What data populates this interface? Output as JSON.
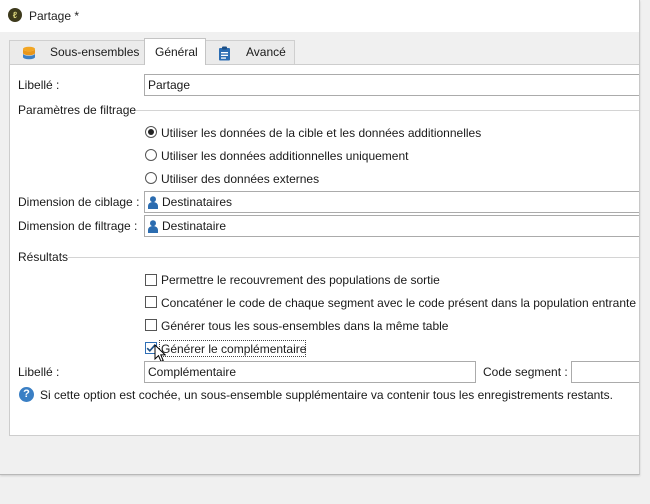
{
  "window": {
    "title": "Partage *"
  },
  "tabs": [
    {
      "label": "Sous-ensembles",
      "icon": "database-icon",
      "active": false
    },
    {
      "label": "Général",
      "active": true
    },
    {
      "label": "Avancé",
      "icon": "clipboard-icon",
      "active": false
    }
  ],
  "form": {
    "libelle_label": "Libellé :",
    "libelle_value": "Partage",
    "filtering_section": "Paramètres de filtrage",
    "radio_options": [
      {
        "label": "Utiliser les données de la cible et les données additionnelles",
        "checked": true
      },
      {
        "label": "Utiliser les données additionnelles uniquement",
        "checked": false
      },
      {
        "label": "Utiliser des données externes",
        "checked": false
      }
    ],
    "targeting_label": "Dimension de ciblage :",
    "targeting_value": "Destinataires",
    "filtering_label": "Dimension de filtrage :",
    "filtering_value": "Destinataire",
    "results_section": "Résultats",
    "checkboxes": [
      {
        "label": "Permettre le recouvrement des populations de sortie",
        "checked": false
      },
      {
        "label": "Concaténer le code de chaque segment avec le code présent dans la population entrante",
        "checked": false
      },
      {
        "label": "Générer tous les sous-ensembles dans la même table",
        "checked": false
      },
      {
        "label": "Générer le complémentaire",
        "checked": true
      }
    ],
    "complement_label": "Libellé :",
    "complement_value": "Complémentaire",
    "segment_code_label": "Code segment :",
    "segment_code_value": "",
    "help_text": "Si cette option est cochée, un sous-ensemble supplémentaire va contenir tous les enregistrements restants."
  },
  "colors": {
    "accent": "#2f6fb6",
    "person_icon": "#2b6cb0",
    "help_icon": "#3a7fc4"
  }
}
